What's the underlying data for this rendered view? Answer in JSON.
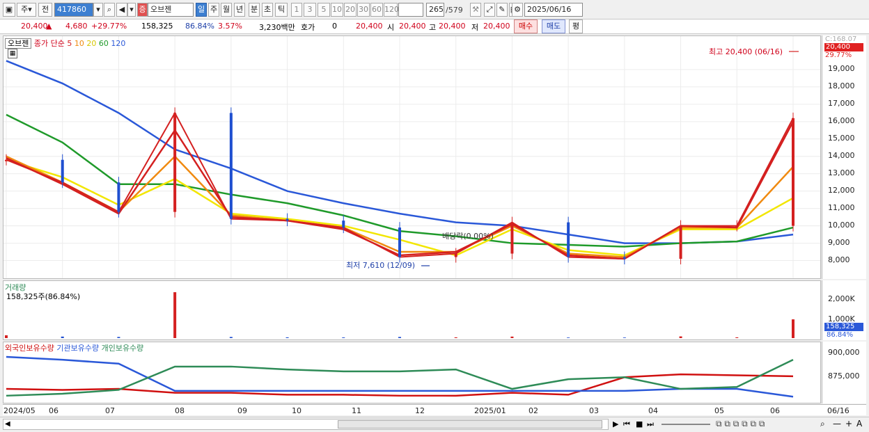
{
  "toolbar": {
    "period_week": "주",
    "period_label2": "전",
    "code": "417860",
    "stock_name": "오브젠",
    "tabs": [
      "일",
      "주",
      "월",
      "년",
      "분",
      "초",
      "틱"
    ],
    "nums": [
      "1",
      "3",
      "5",
      "10",
      "20",
      "30",
      "60",
      "120"
    ],
    "count": "265",
    "total": "/579",
    "date": "2025/06/16"
  },
  "quote": {
    "price": "20,400",
    "change": "4,680",
    "change_pct": "+29.77%",
    "volume": "158,325",
    "vol_ratio": "86.84%",
    "turnover_pct": "3.57%",
    "amount": "3,230백만",
    "hoga_label": "호가",
    "hoga_val": "0",
    "bid": "20,400",
    "open_label": "시",
    "open": "20,400",
    "high_label": "고",
    "high": "20,400",
    "low_label": "저",
    "low": "20,400",
    "buy": "매수",
    "sell": "매도",
    "flat": "평"
  },
  "price_panel": {
    "name_label": "오브젠",
    "ma_label": "종가 단순",
    "ma_periods": [
      "5",
      "10",
      "20",
      "60",
      "120"
    ],
    "ma_colors": [
      "#d42020",
      "#f08a10",
      "#f2e600",
      "#1f9a2a",
      "#2a58d8"
    ],
    "top_note": "C:168.07",
    "price_tag": "20,400",
    "pct_tag": "29.77%",
    "max_note": "최고 20,400 (06/16)",
    "min_note": "최저 7,610 (12/09)",
    "ex_note": "배당락(0.00%)",
    "ticks": [
      "19,000",
      "18,000",
      "17,000",
      "16,000",
      "15,000",
      "14,000",
      "13,000",
      "12,000",
      "11,000",
      "10,000",
      "9,000",
      "8,000"
    ]
  },
  "volume_panel": {
    "title": "거래량",
    "value_text": "158,325주(86.84%)",
    "ticks": [
      "2,000K",
      "1,000K"
    ],
    "tag": "158,325",
    "tag_pct": "86.84%"
  },
  "holding_panel": {
    "legend": [
      "외국인보유수량",
      "기관보유수량",
      "개인보유수량"
    ],
    "legend_colors": [
      "#d01010",
      "#2a58d8",
      "#2e8b57"
    ],
    "ticks": [
      "900,000",
      "875,000"
    ]
  },
  "dates": [
    "2024/05",
    "06",
    "07",
    "08",
    "09",
    "10",
    "11",
    "12",
    "2025/01",
    "02",
    "03",
    "04",
    "05",
    "06",
    "06/16"
  ],
  "chart_data": {
    "type": "line",
    "title": "오브젠",
    "xlabel": "",
    "ylabel": "",
    "ylim": [
      7300,
      20600
    ],
    "x": [
      "2024/05",
      "06",
      "07",
      "08",
      "09",
      "10",
      "11",
      "12",
      "2025/01",
      "02",
      "03",
      "04",
      "05",
      "06",
      "06/16"
    ],
    "series": [
      {
        "name": "종가",
        "values": [
          13800,
          12500,
          10800,
          16500,
          10400,
          10300,
          9900,
          8200,
          8400,
          10200,
          8200,
          8100,
          10000,
          10000,
          16200
        ]
      },
      {
        "name": "5",
        "values": [
          13900,
          12400,
          10700,
          15500,
          10500,
          10300,
          9800,
          8300,
          8500,
          10100,
          8300,
          8100,
          10000,
          9900,
          16000
        ]
      },
      {
        "name": "10",
        "values": [
          14000,
          12500,
          10800,
          14000,
          10600,
          10300,
          9900,
          8500,
          8500,
          10000,
          8400,
          8200,
          9900,
          9900,
          13400
        ]
      },
      {
        "name": "20",
        "values": [
          13800,
          12800,
          11200,
          12700,
          10700,
          10400,
          10000,
          9200,
          8300,
          9800,
          8600,
          8300,
          9800,
          9800,
          11600
        ]
      },
      {
        "name": "60",
        "values": [
          16400,
          14800,
          12400,
          12400,
          11800,
          11300,
          10600,
          9700,
          9400,
          9000,
          8900,
          8800,
          9000,
          9100,
          9900
        ]
      },
      {
        "name": "120",
        "values": [
          19500,
          18200,
          16500,
          14400,
          13300,
          12000,
          11300,
          10700,
          10200,
          10000,
          9500,
          9000,
          9000,
          9100,
          9500
        ]
      }
    ],
    "volume_K": [
      150,
      80,
      60,
      2450,
      60,
      40,
      35,
      60,
      40,
      80,
      30,
      30,
      90,
      40,
      1000
    ],
    "holdings": {
      "ylim": [
        860000,
        908000
      ],
      "foreign": [
        870000,
        869000,
        870000,
        866000,
        866000,
        864000,
        864000,
        863000,
        863000,
        866000,
        864000,
        882000,
        885000,
        884000,
        883000
      ],
      "institution": [
        903000,
        900000,
        896000,
        868000,
        868000,
        868000,
        868000,
        868000,
        868000,
        868000,
        868000,
        868000,
        870000,
        870000,
        862000
      ],
      "individual": [
        863000,
        865000,
        869000,
        893000,
        893000,
        890000,
        888000,
        888000,
        890000,
        870000,
        880000,
        882000,
        870000,
        872000,
        900000
      ]
    }
  }
}
